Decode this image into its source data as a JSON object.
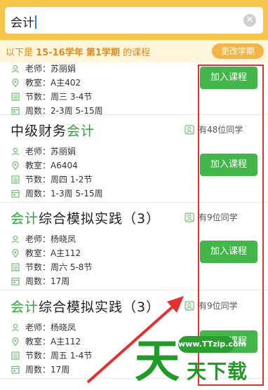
{
  "search": {
    "value": "会计",
    "clear_icon": "close-circle-icon"
  },
  "semester": {
    "prefix": "以下是 ",
    "year": "15-16学年",
    "term": "第1学期",
    "suffix": " 的课程",
    "change_label": "更改学期"
  },
  "courses": [
    {
      "title_hl": "",
      "title_rest": "",
      "classmates": "",
      "teacher": "老师：苏丽娟",
      "room": "教室：A主402",
      "period": "节数：周三 3-4节",
      "weeks": "周数：2-3周 5-15周",
      "join_label": "加入课程"
    },
    {
      "title_pre": "中级财务",
      "title_hl": "会计",
      "title_rest": "",
      "classmates": "有48位同学",
      "teacher": "老师：苏丽娟",
      "room": "教室：A6404",
      "period": "节数：周四 1-2节",
      "weeks": "周数：1-3周 5-15周",
      "join_label": "加入课程"
    },
    {
      "title_hl": "会计",
      "title_rest": "综合模拟实践（3）",
      "classmates": "有9位同学",
      "teacher": "老师：杨晓凤",
      "room": "教室：A主112",
      "period": "节数：周六 5-8节",
      "weeks": "周数：17周",
      "join_label": "加入课程"
    },
    {
      "title_hl": "会计",
      "title_rest": "综合模拟实践（3）",
      "classmates": "有9位同学",
      "teacher": "老师：杨晓凤",
      "room": "教室：A主112",
      "period": "节数：周五 1-4节",
      "weeks": "周数：17周",
      "join_label": "加入课程"
    }
  ],
  "watermark": {
    "url": "www.TTzip.com",
    "big": "天",
    "text": "天下载"
  },
  "colors": {
    "accent_green": "#43b649",
    "header_yellow": "#f5c64a",
    "annotation_red": "#e53030"
  }
}
